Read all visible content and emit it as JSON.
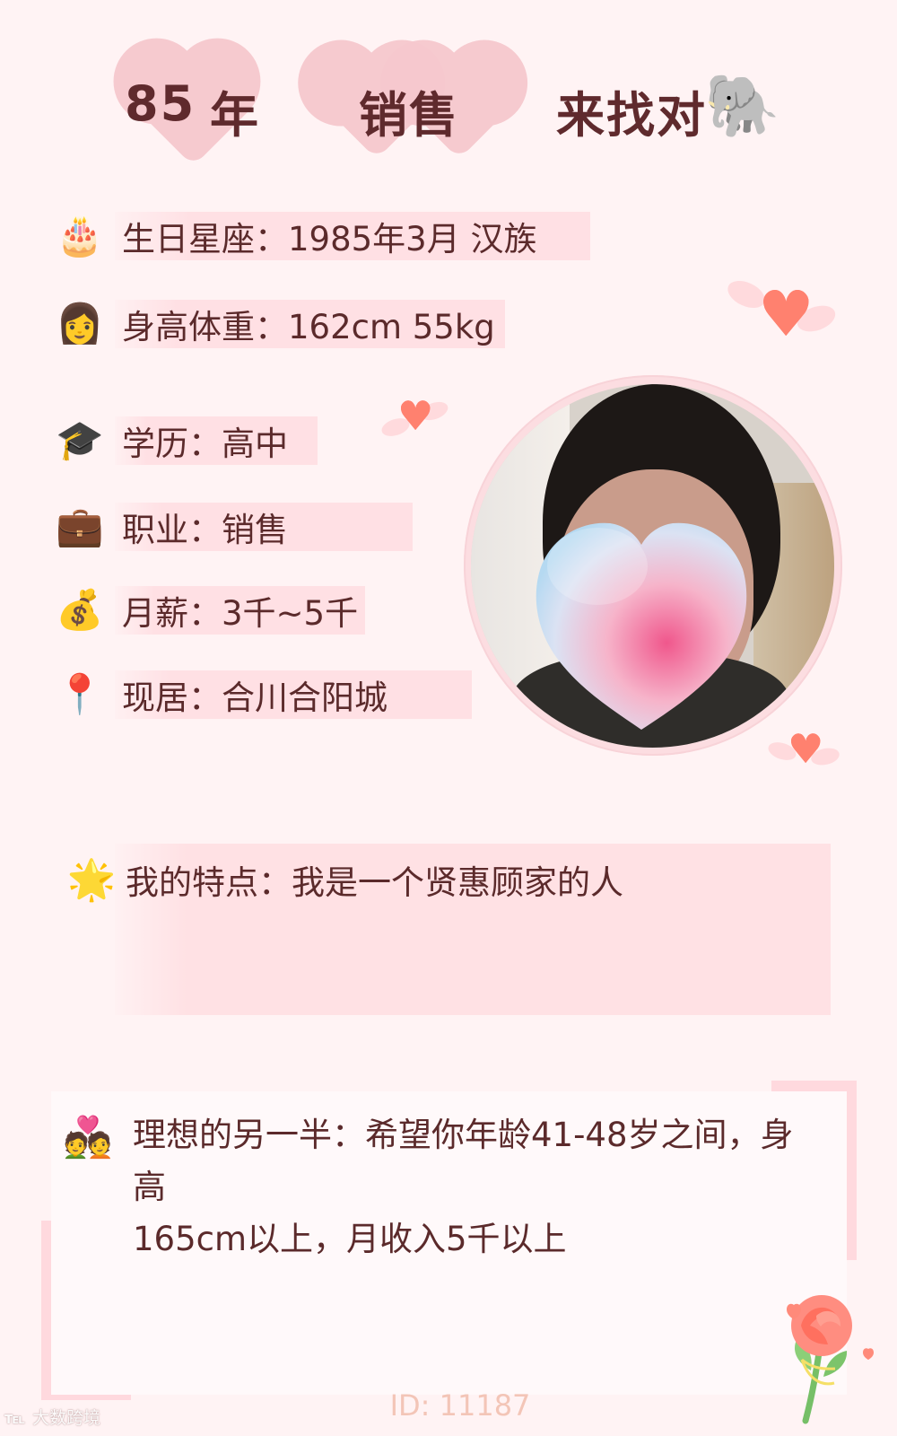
{
  "header": {
    "age": "85",
    "year_unit": "年",
    "occupation": "销售",
    "phrase": "来找对",
    "emoji": "🐘"
  },
  "info": [
    {
      "icon": "🎂",
      "icon_name": "birthday-cake-icon",
      "label": "生日星座：1985年3月 汉族"
    },
    {
      "icon": "👩",
      "icon_name": "woman-icon",
      "label": "身高体重：162cm 55kg"
    },
    {
      "icon": "🎓",
      "icon_name": "graduation-cap-icon",
      "label": "学历：高中"
    },
    {
      "icon": "💼",
      "icon_name": "briefcase-icon",
      "label": "职业：销售"
    },
    {
      "icon": "💰",
      "icon_name": "money-bag-icon",
      "label": "月薪：3千~5千"
    },
    {
      "icon": "📍",
      "icon_name": "location-pin-icon",
      "label": "现居：合川合阳城"
    }
  ],
  "feature": {
    "icon": "🌟",
    "icon_name": "star-icon",
    "label": "我的特点：我是一个贤惠顾家的人"
  },
  "ideal": {
    "icon": "💑",
    "icon_name": "couple-heart-icon",
    "line1": "理想的另一半：希望你年龄41-48岁之间，身高",
    "line2": "165cm以上，月收入5千以上"
  },
  "footer": {
    "id": "ID: 11187",
    "watermark_mark": "℡",
    "watermark_text": "大数跨境"
  },
  "colors": {
    "background": "#fff3f4",
    "text": "#5b2a2b",
    "pink_box": "#ffe0e4",
    "accent": "#ff816f"
  }
}
